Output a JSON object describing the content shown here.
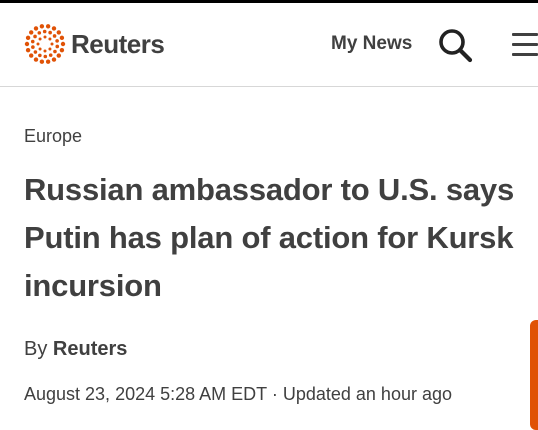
{
  "brand": {
    "name": "Reuters",
    "accent_color": "#e05206"
  },
  "header": {
    "my_news_label": "My News",
    "search_icon": "search-icon",
    "menu_icon": "hamburger-menu-icon"
  },
  "article": {
    "section": "Europe",
    "title": "Russian ambassador to U.S. says Putin has plan of action for Kursk incursion",
    "byline_prefix": "By",
    "author": "Reuters",
    "published": "August 23, 2024 5:28 AM EDT",
    "separator": "·",
    "updated": "Updated an hour ago"
  }
}
